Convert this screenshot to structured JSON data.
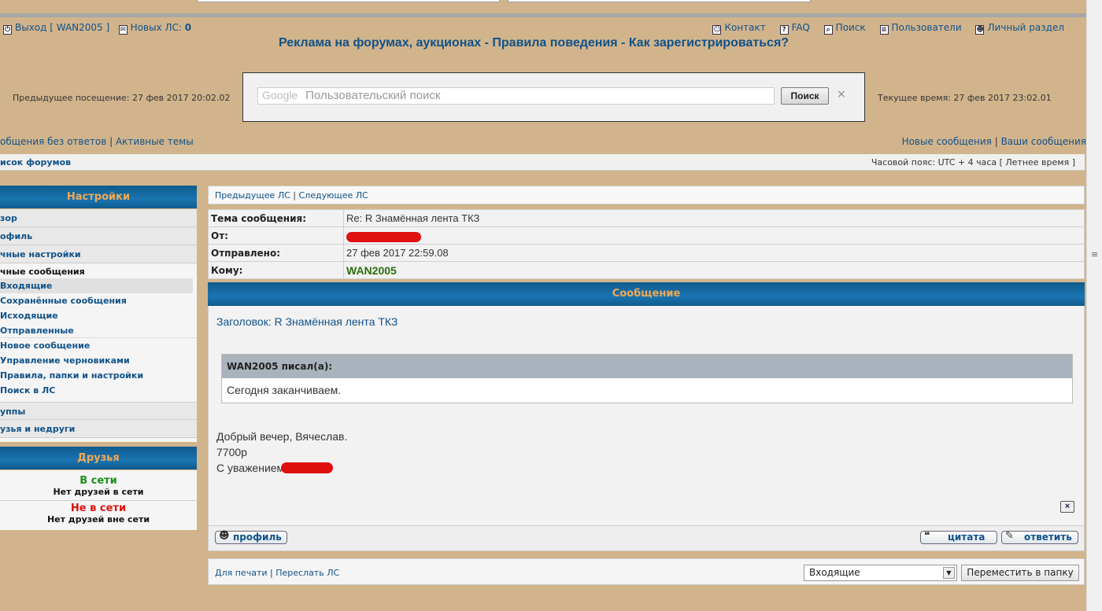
{
  "userbar": {
    "logout_label": "Выход [ WAN2005 ]",
    "new_pm_label": "Новых ЛС:",
    "new_pm_count": "0",
    "links": {
      "contact": "Контакт",
      "faq": "FAQ",
      "search": "Поиск",
      "users": "Пользователи",
      "ucp": "Личный раздел"
    }
  },
  "headline": {
    "ads": "Реклама на форумах, аукционах",
    "rules": "Правила поведения",
    "register": "Как зарегистрироваться?",
    "sep": " - "
  },
  "visits": {
    "previous": "Предыдущее посещение: 27 фев 2017 20:02.02",
    "current": "Текущее время: 27 фев 2017 23:02.01"
  },
  "google_search": {
    "brand": "Google",
    "placeholder": "Пользовательский поиск",
    "button": "Поиск",
    "clear": "×"
  },
  "nav": {
    "unanswered": "общения без ответов",
    "active": "Активные темы",
    "new_posts": "Новые сообщения",
    "your_posts": "Ваши сообщения",
    "sep": " | "
  },
  "crumbs": {
    "index": "исок форумов",
    "timezone": "Часовой пояс: UTC + 4 часа [ Летнее время ]"
  },
  "settings_panel": {
    "title": "Настройки",
    "items": [
      "зор",
      "офиль",
      "чные настройки"
    ],
    "pm_header": "чные сообщения",
    "pm_items": [
      {
        "label": "Входящие",
        "active": true
      },
      {
        "label": "Сохранённые сообщения",
        "active": false
      },
      {
        "label": "Исходящие",
        "active": false
      },
      {
        "label": "Отправленные",
        "active": false
      },
      {
        "label": "Новое сообщение",
        "active": false
      },
      {
        "label": "Управление черновиками",
        "active": false
      },
      {
        "label": "Правила, папки и настройки",
        "active": false
      },
      {
        "label": "Поиск в ЛС",
        "active": false
      }
    ],
    "bottom_items": [
      "уппы",
      "узья и недруги"
    ]
  },
  "friends_panel": {
    "title": "Друзья",
    "online_label": "В сети",
    "online_note": "Нет друзей в сети",
    "offline_label": "Не в сети",
    "offline_note": "Нет друзей вне сети"
  },
  "pm_nav": {
    "prev": "Предыдущее ЛС",
    "next": "Следующее ЛС",
    "sep": " | "
  },
  "message_meta": {
    "subject_label": "Тема сообщения:",
    "subject_value": "Re: R Знамённая лента ТКЗ",
    "from_label": "От:",
    "sent_label": "Отправлено:",
    "sent_value": "27 фев 2017 22:59.08",
    "to_label": "Кому:",
    "to_value": "WAN2005"
  },
  "message": {
    "title": "Сообщение",
    "subject_line": "Заголовок: R Знамённая лента ТКЗ",
    "quote_author": "WAN2005 писал(а):",
    "quote_text": "Сегодня заканчиваем.",
    "line1": "Добрый вечер, Вячеслав.",
    "line2": "7700р",
    "line3": "С уважением,",
    "close_icon": "×"
  },
  "actions": {
    "profile": "профиль",
    "quote": "цитата",
    "reply": "ответить"
  },
  "footer": {
    "print": "Для печати",
    "forward": "Переслать ЛС",
    "sep": " | ",
    "folder_selected": "Входящие",
    "move_button": "Переместить в папку"
  },
  "colors": {
    "page_bg": "#d2b48c",
    "header_blue": "#0f5a8d",
    "header_text": "#f0a855",
    "link": "#105289",
    "online": "#1a8f1a",
    "offline": "#dd1111",
    "redaction": "#e01010"
  }
}
